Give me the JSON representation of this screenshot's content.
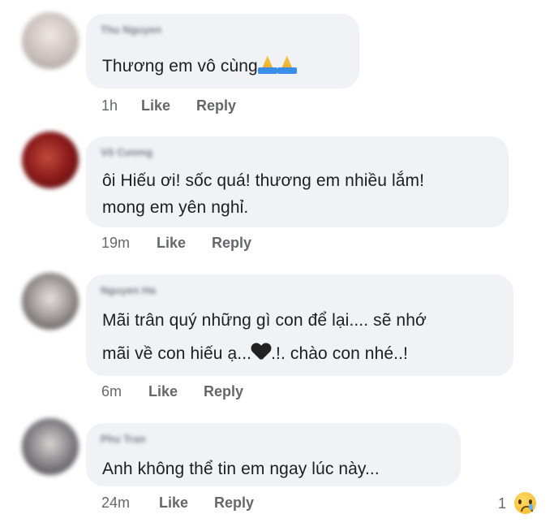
{
  "comments": [
    {
      "author": "Thu Nguyen",
      "text_lines": [
        "Thương em vô cùng"
      ],
      "emoji_after": "folded-hands x2",
      "time": "1h",
      "like": "Like",
      "reply": "Reply",
      "avatar_color": "#c9c0bc"
    },
    {
      "author": "Võ Cương",
      "text_lines": [
        "ôi Hiếu ơi! sốc quá! thương em nhiều lắm!",
        "mong em yên nghỉ."
      ],
      "time": "19m",
      "like": "Like",
      "reply": "Reply",
      "avatar_color": "#8a1a1a"
    },
    {
      "author": "Nguyen Ha",
      "text_lines": [
        "Mãi trân quý những gì con để lại.... sẽ nhớ",
        "mãi về con hiếu ạ...",
        ".!. chào con nhé..!"
      ],
      "time": "6m",
      "like": "Like",
      "reply": "Reply",
      "avatar_color": "#6e6a68"
    },
    {
      "author": "Phu Tran",
      "text_lines": [
        "Anh không thể tin em ngay lúc này..."
      ],
      "time": "24m",
      "like": "Like",
      "reply": "Reply",
      "reaction_count": "1",
      "reaction_icon": "sad-face",
      "avatar_color": "#7d7b80"
    }
  ]
}
